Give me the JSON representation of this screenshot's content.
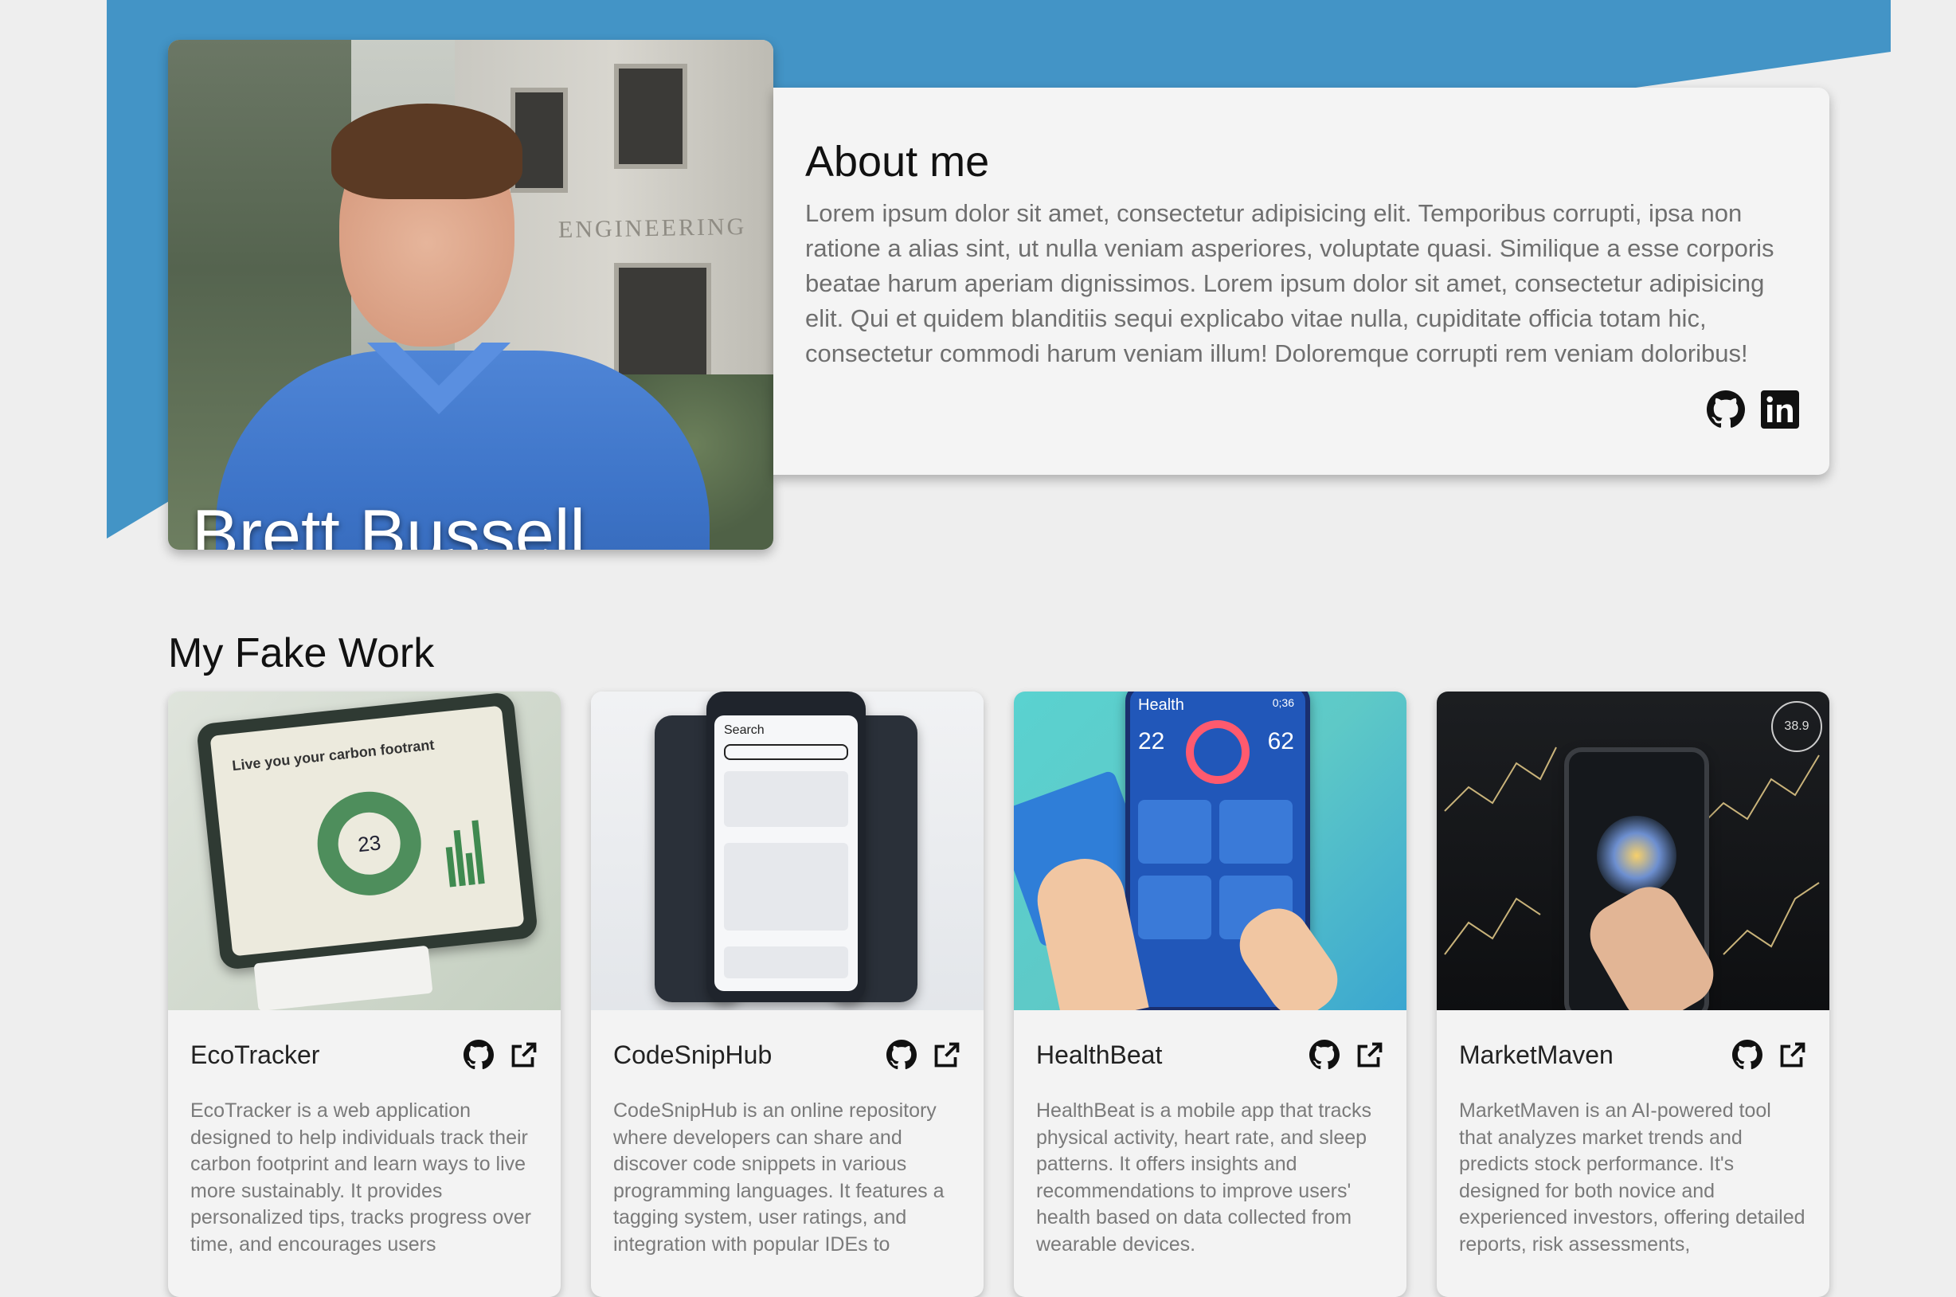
{
  "profile": {
    "name": "Brett Bussell",
    "photo_engraving": "ENGINEERING"
  },
  "about": {
    "title": "About me",
    "text": "Lorem ipsum dolor sit amet, consectetur adipisicing elit. Temporibus corrupti, ipsa non ratione a alias sint, ut nulla veniam asperiores, voluptate quasi. Similique a esse corporis beatae harum aperiam dignissimos. Lorem ipsum dolor sit amet, consectetur adipisicing elit. Qui et quidem blanditiis sequi explicabo vitae nulla, cupiditate officia totam hic, consectetur commodi harum veniam illum! Doloremque corrupti rem veniam doloribus!",
    "icons": [
      "github-icon",
      "linkedin-icon"
    ]
  },
  "work": {
    "title": "My Fake Work",
    "projects": [
      {
        "name": "EcoTracker",
        "description": "EcoTracker is a web application designed to help individuals track their carbon footprint and learn ways to live more sustainably. It provides personalized tips, tracks progress over time, and encourages users",
        "image_text": "Live you your carbon footrant",
        "image_number": "23"
      },
      {
        "name": "CodeSnipHub",
        "description": "CodeSnipHub is an online repository where developers can share and discover code snippets in various programming languages. It features a tagging system, user ratings, and integration with popular IDEs to",
        "image_text": "Search"
      },
      {
        "name": "HealthBeat",
        "description": "HealthBeat is a mobile app that tracks physical activity, heart rate, and sleep patterns. It offers insights and recommendations to improve users' health based on data collected from wearable devices.",
        "image_text": "Health",
        "image_numbers": [
          "22",
          "62",
          "0;36"
        ]
      },
      {
        "name": "MarketMaven",
        "description": "MarketMaven is an AI-powered tool that analyzes market trends and predicts stock performance. It's designed for both novice and experienced investors, offering detailed reports, risk assessments,",
        "image_text": "38.9"
      }
    ]
  },
  "colors": {
    "hero": "#4394c6",
    "background": "#eeeeee",
    "card": "#f3f3f3"
  }
}
